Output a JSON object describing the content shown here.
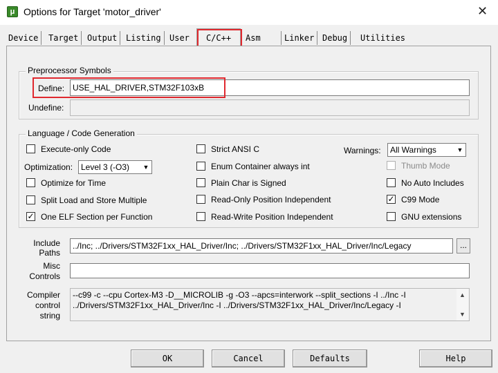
{
  "window": {
    "title": "Options for Target 'motor_driver'",
    "app_icon": "μ",
    "close_glyph": "✕"
  },
  "tabs": [
    {
      "label": "Device"
    },
    {
      "label": "Target"
    },
    {
      "label": "Output"
    },
    {
      "label": "Listing"
    },
    {
      "label": "User"
    },
    {
      "label": "C/C++"
    },
    {
      "label": "Asm"
    },
    {
      "label": "Linker"
    },
    {
      "label": "Debug"
    },
    {
      "label": "Utilities"
    }
  ],
  "active_tab": "C/C++",
  "highlight_color": "#e0282e",
  "preprocessor": {
    "title": "Preprocessor Symbols",
    "define_label": "Define:",
    "define_value": "USE_HAL_DRIVER,STM32F103xB",
    "undefine_label": "Undefine:",
    "undefine_value": ""
  },
  "codegen": {
    "title": "Language / Code Generation",
    "execute_only": {
      "label": "Execute-only Code",
      "checked": false
    },
    "optimization_label": "Optimization:",
    "optimization_value": "Level 3 (-O3)",
    "optimize_time": {
      "label": "Optimize for Time",
      "checked": false
    },
    "split_load": {
      "label": "Split Load and Store Multiple",
      "checked": false
    },
    "one_elf": {
      "label": "One ELF Section per Function",
      "checked": true
    },
    "strict_ansi": {
      "label": "Strict ANSI C",
      "checked": false
    },
    "enum_int": {
      "label": "Enum Container always int",
      "checked": false
    },
    "plain_char": {
      "label": "Plain Char is Signed",
      "checked": false
    },
    "ro_pi": {
      "label": "Read-Only Position Independent",
      "checked": false
    },
    "rw_pi": {
      "label": "Read-Write Position Independent",
      "checked": false
    },
    "warnings_label": "Warnings:",
    "warnings_value": "All Warnings",
    "thumb_mode": {
      "label": "Thumb Mode",
      "checked": false,
      "disabled": true
    },
    "no_auto_includes": {
      "label": "No Auto Includes",
      "checked": false
    },
    "c99": {
      "label": "C99 Mode",
      "checked": true
    },
    "gnu_ext": {
      "label": "GNU extensions",
      "checked": false
    }
  },
  "include_paths": {
    "label_line1": "Include",
    "label_line2": "Paths",
    "value": "../Inc;     ../Drivers/STM32F1xx_HAL_Driver/Inc;     ../Drivers/STM32F1xx_HAL_Driver/Inc/Legacy",
    "browse_label": "..."
  },
  "misc_controls": {
    "label_line1": "Misc",
    "label_line2": "Controls",
    "value": ""
  },
  "compiler_string": {
    "label_line1": "Compiler",
    "label_line2": "control",
    "label_line3": "string",
    "value": "--c99 -c --cpu Cortex-M3 -D__MICROLIB -g -O3 --apcs=interwork --split_sections -I ../Inc -I ../Drivers/STM32F1xx_HAL_Driver/Inc -I ../Drivers/STM32F1xx_HAL_Driver/Inc/Legacy -I"
  },
  "buttons": {
    "ok": "OK",
    "cancel": "Cancel",
    "defaults": "Defaults",
    "help": "Help"
  },
  "glyphs": {
    "dropdown": "▼",
    "check": "✓",
    "scroll_up": "▲",
    "scroll_down": "▼"
  }
}
